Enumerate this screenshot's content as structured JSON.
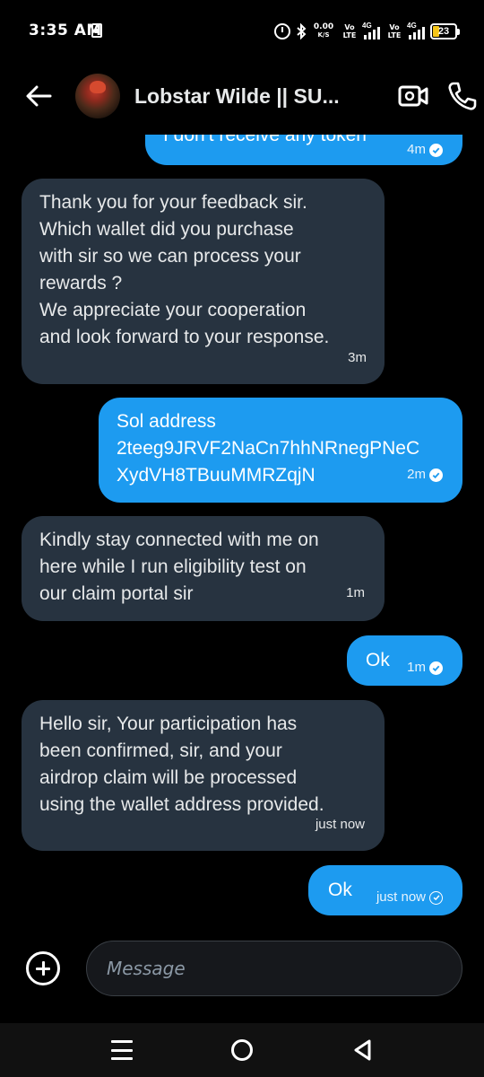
{
  "status_bar": {
    "time": "3:35 AM",
    "net_speed_value": "0.00",
    "net_speed_unit": "K/S",
    "sim1_volte_top": "Vo",
    "sim1_volte_bottom": "LTE",
    "sim1_network": "4G",
    "sim2_volte_top": "Vo",
    "sim2_volte_bottom": "LTE",
    "sim2_network": "4G",
    "battery_level": "23"
  },
  "header": {
    "contact_name": "Lobstar Wilde || SU...",
    "icons": [
      "back-arrow-icon",
      "video-call-icon",
      "phone-call-icon"
    ]
  },
  "messages": [
    {
      "direction": "sent",
      "text": "I don't receive any token",
      "time": "4m",
      "status": "read"
    },
    {
      "direction": "received",
      "text": "Thank you for your feedback sir.\nWhich wallet did you purchase\nwith  sir so we can process your\nrewards ?\nWe appreciate your cooperation\nand look forward to your response.",
      "time": "3m"
    },
    {
      "direction": "sent",
      "text": "Sol address\n2teeg9JRVF2NaCn7hhNRnegPNeC\nXydVH8TBuuMMRZqjN",
      "time": "2m",
      "status": "read"
    },
    {
      "direction": "received",
      "text": "Kindly stay connected with me on\nhere while I run eligibility test on\nour claim portal sir",
      "time": "1m"
    },
    {
      "direction": "sent",
      "text": "Ok",
      "time": "1m",
      "status": "read"
    },
    {
      "direction": "received",
      "text": "Hello sir, Your participation has\nbeen confirmed, sir, and your\nairdrop claim will be processed\nusing the wallet address provided.",
      "time": "just now"
    },
    {
      "direction": "sent",
      "text": "Ok",
      "time": "just now",
      "status": "sent"
    }
  ],
  "composer": {
    "placeholder": "Message"
  },
  "colors": {
    "sent_bubble": "#1d9bf0",
    "received_bubble": "#273340",
    "background": "#000000"
  }
}
